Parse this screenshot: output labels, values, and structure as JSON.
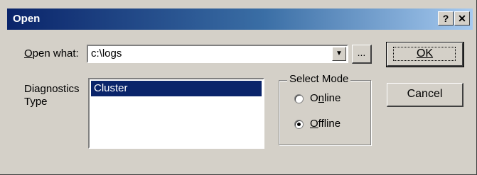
{
  "dialog": {
    "title": "Open",
    "help_label": "?",
    "close_label": "✕"
  },
  "open_what": {
    "label_accesskey": "O",
    "label_rest": "pen what:",
    "value": "c:\\logs",
    "dropdown_glyph": "▼",
    "browse_label": "..."
  },
  "diagnostics": {
    "label_line1": "Diagnostics",
    "label_line2": "Type",
    "items": [
      "Cluster"
    ]
  },
  "select_mode": {
    "legend": "Select Mode",
    "options": [
      {
        "pre": "O",
        "accesskey": "n",
        "post": "line",
        "selected": false
      },
      {
        "pre": "",
        "accesskey": "O",
        "post": "ffline",
        "selected": true
      }
    ]
  },
  "buttons": {
    "ok_label": "OK",
    "cancel_label": "Cancel"
  }
}
